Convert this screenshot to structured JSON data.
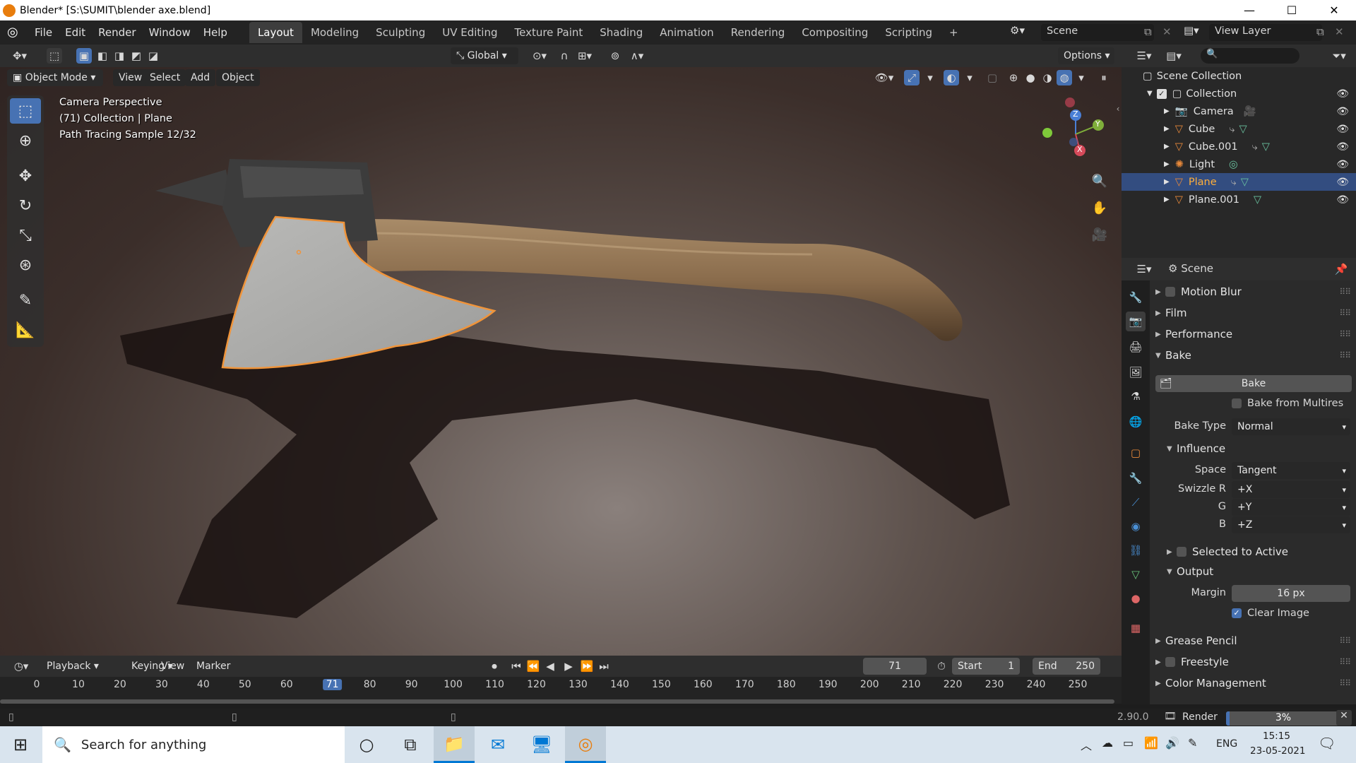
{
  "window": {
    "title": "Blender* [S:\\SUMIT\\blender axe.blend]",
    "minimize": "—",
    "maximize": "☐",
    "close": "✕"
  },
  "menu": [
    "File",
    "Edit",
    "Render",
    "Window",
    "Help"
  ],
  "workspaces": [
    "Layout",
    "Modeling",
    "Sculpting",
    "UV Editing",
    "Texture Paint",
    "Shading",
    "Animation",
    "Rendering",
    "Compositing",
    "Scripting"
  ],
  "active_workspace": "Layout",
  "scene_name": "Scene",
  "view_layer": "View Layer",
  "viewport": {
    "transform_orientation": "Global",
    "options_label": "Options",
    "mode": "Object Mode",
    "menus": [
      "View",
      "Select",
      "Add",
      "Object"
    ],
    "overlay_lines": [
      "Camera Perspective",
      "(71) Collection | Plane",
      "Path Tracing Sample 12/32"
    ],
    "gizmo_axes": {
      "x": "X",
      "y": "Y",
      "z": "Z"
    }
  },
  "outliner": {
    "root": "Scene Collection",
    "collection": "Collection",
    "items": [
      {
        "name": "Camera",
        "selected": false
      },
      {
        "name": "Cube",
        "selected": false
      },
      {
        "name": "Cube.001",
        "selected": false
      },
      {
        "name": "Light",
        "selected": false
      },
      {
        "name": "Plane",
        "selected": true
      },
      {
        "name": "Plane.001",
        "selected": false
      }
    ]
  },
  "properties": {
    "context": "Scene",
    "panels_top": [
      "Motion Blur",
      "Film",
      "Performance",
      "Bake"
    ],
    "bake_button": "Bake",
    "bake_from_multires": "Bake from Multires",
    "bake_type_label": "Bake Type",
    "bake_type_value": "Normal",
    "influence": "Influence",
    "space_label": "Space",
    "space_value": "Tangent",
    "swizzle_r_label": "Swizzle R",
    "swizzle_r": "+X",
    "g_label": "G",
    "swizzle_g": "+Y",
    "b_label": "B",
    "swizzle_b": "+Z",
    "selected_to_active": "Selected to Active",
    "output": "Output",
    "margin_label": "Margin",
    "margin_value": "16 px",
    "clear_image": "Clear Image",
    "panels_bottom": [
      "Grease Pencil",
      "Freestyle",
      "Color Management"
    ]
  },
  "timeline": {
    "menus": [
      "Playback",
      "Keying",
      "View",
      "Marker"
    ],
    "current_frame": "71",
    "start_label": "Start",
    "start": "1",
    "end_label": "End",
    "end": "250",
    "ticks": [
      "0",
      "10",
      "20",
      "30",
      "40",
      "50",
      "60",
      "71",
      "80",
      "90",
      "100",
      "110",
      "120",
      "130",
      "140",
      "150",
      "160",
      "170",
      "180",
      "190",
      "200",
      "210",
      "220",
      "230",
      "240",
      "250"
    ]
  },
  "status": {
    "version": "2.90.0",
    "render_label": "Render",
    "render_progress": "3%",
    "render_fraction": 0.03
  },
  "taskbar": {
    "search_placeholder": "Search for anything",
    "language": "ENG",
    "time": "15:15",
    "date": "23-05-2021"
  },
  "colors": {
    "accent": "#4772b3",
    "selection_outline": "#f0943a",
    "blender_orange": "#e87d0d"
  }
}
